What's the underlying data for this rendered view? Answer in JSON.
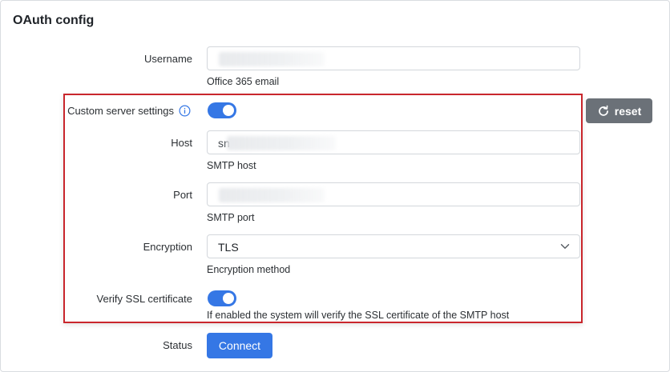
{
  "panel": {
    "title": "OAuth config"
  },
  "username": {
    "label": "Username",
    "help": "Office 365 email"
  },
  "custom_server": {
    "label": "Custom server settings",
    "enabled": true
  },
  "reset": {
    "label": "reset"
  },
  "host": {
    "label": "Host",
    "value": "sn",
    "help": "SMTP host"
  },
  "port": {
    "label": "Port",
    "help": "SMTP port"
  },
  "encryption": {
    "label": "Encryption",
    "selected": "TLS",
    "help": "Encryption method"
  },
  "verify_ssl": {
    "label": "Verify SSL certificate",
    "enabled": true,
    "help": "If enabled the system will verify the SSL certificate of the SMTP host"
  },
  "status": {
    "label": "Status",
    "connect_label": "Connect"
  },
  "colors": {
    "accent": "#3577e5",
    "highlight_border": "#c9262c",
    "reset_bg": "#6b7178"
  },
  "icons": {
    "info": "info-icon",
    "reset": "refresh-icon",
    "dropdown": "chevron-down-icon"
  }
}
